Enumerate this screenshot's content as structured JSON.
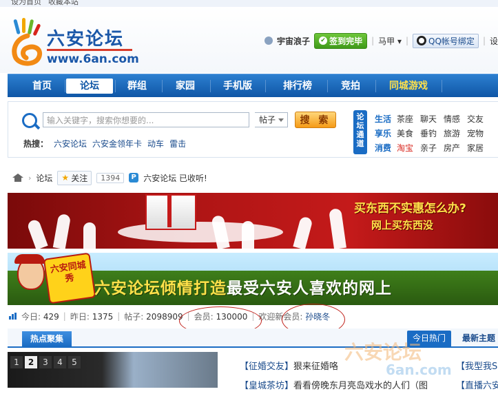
{
  "topbar": {
    "set_home": "设为首页",
    "bookmark": "收藏本站"
  },
  "logo": {
    "cn": "六安论坛",
    "url": "www.6an.com"
  },
  "user": {
    "name": "宇宙浪子",
    "checkin": "签到完毕",
    "horse": "马甲",
    "qq_bind": "QQ帐号绑定",
    "settings": "设"
  },
  "nav": {
    "items": [
      {
        "label": "首页"
      },
      {
        "label": "论坛"
      },
      {
        "label": "群组"
      },
      {
        "label": "家园"
      },
      {
        "label": "手机版"
      },
      {
        "label": "排行榜"
      },
      {
        "label": "竞拍"
      },
      {
        "label": "同城游戏"
      }
    ]
  },
  "search": {
    "placeholder": "输入关键字，搜索你想要的...",
    "scope": "帖子",
    "button": "搜 索",
    "hot_label": "热搜：",
    "hot_items": [
      "六安论坛",
      "六安金领年卡",
      "动车",
      "雷击"
    ]
  },
  "channels": {
    "tag": "论坛通道",
    "rows": [
      {
        "cat": "生活",
        "links": [
          "茶座",
          "聊天",
          "情感",
          "交友"
        ]
      },
      {
        "cat": "享乐",
        "links": [
          "美食",
          "垂钓",
          "旅游",
          "宠物"
        ]
      },
      {
        "cat": "消费",
        "links": [
          "淘宝",
          "亲子",
          "房产",
          "家居"
        ]
      }
    ]
  },
  "breadcrumb": {
    "forum": "论坛",
    "follow": "关注",
    "follow_count": "1394",
    "collected": "六安论坛 已收听!"
  },
  "banner1": {
    "line1": "买东西不实惠怎么办?",
    "line2": "网上买东西没"
  },
  "banner2": {
    "badge": "六安同城秀",
    "title_a": "六安论坛倾情打造",
    "title_b": "最受六安人喜欢的网上"
  },
  "stats": {
    "today_label": "今日:",
    "today": "429",
    "yesterday_label": "昨日:",
    "yesterday": "1375",
    "posts_label": "帖子:",
    "posts": "2098909",
    "members_label": "会员:",
    "members": "130000",
    "welcome_label": "欢迎新会员:",
    "new_member": "孙晓冬"
  },
  "tabs": {
    "hot": "热点聚集",
    "today_hot": "今日热门",
    "latest": "最新主题"
  },
  "slider": {
    "pages": [
      "1",
      "2",
      "3",
      "4",
      "5"
    ],
    "active": "2"
  },
  "posts": [
    {
      "tag": "【征婚交友】",
      "title": "狠来征婚咯"
    },
    {
      "tag": "【皇城茶坊】",
      "title": "看看傍晚东月亮岛戏水的人们（图"
    }
  ],
  "posts_right": [
    "【我型我SH",
    "【直播六安"
  ],
  "watermark": {
    "cn": "六安论坛",
    "url": "6an.com"
  },
  "colors": {
    "brand_blue": "#1a6cc4",
    "nav_blue": "#0f56a6",
    "accent_orange": "#f59a16",
    "highlight_red": "#c0211a"
  }
}
